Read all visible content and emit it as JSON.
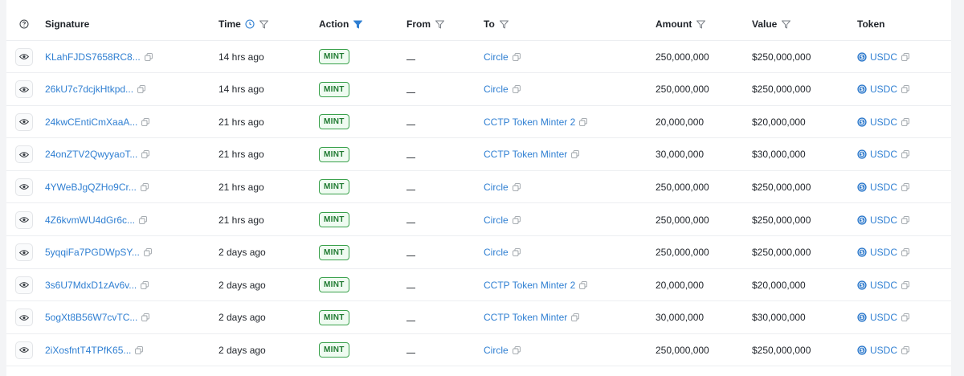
{
  "columns": {
    "signature": "Signature",
    "time": "Time",
    "action": "Action",
    "from": "From",
    "to": "To",
    "amount": "Amount",
    "value": "Value",
    "token": "Token"
  },
  "colors": {
    "link": "#2f7fd2",
    "badge_border": "#3aa14c",
    "active_filter": "#2f7fd2"
  },
  "rows": [
    {
      "signature": "KLahFJDS7658RC8...",
      "time": "14 hrs ago",
      "action": "MINT",
      "from": "",
      "to": "Circle",
      "amount": "250,000,000",
      "value": "$250,000,000",
      "token": "USDC"
    },
    {
      "signature": "26kU7c7dcjkHtkpd...",
      "time": "14 hrs ago",
      "action": "MINT",
      "from": "",
      "to": "Circle",
      "amount": "250,000,000",
      "value": "$250,000,000",
      "token": "USDC"
    },
    {
      "signature": "24kwCEntiCmXaaA...",
      "time": "21 hrs ago",
      "action": "MINT",
      "from": "",
      "to": "CCTP Token Minter 2",
      "amount": "20,000,000",
      "value": "$20,000,000",
      "token": "USDC"
    },
    {
      "signature": "24onZTV2QwyyaoT...",
      "time": "21 hrs ago",
      "action": "MINT",
      "from": "",
      "to": "CCTP Token Minter",
      "amount": "30,000,000",
      "value": "$30,000,000",
      "token": "USDC"
    },
    {
      "signature": "4YWeBJgQZHo9Cr...",
      "time": "21 hrs ago",
      "action": "MINT",
      "from": "",
      "to": "Circle",
      "amount": "250,000,000",
      "value": "$250,000,000",
      "token": "USDC"
    },
    {
      "signature": "4Z6kvmWU4dGr6c...",
      "time": "21 hrs ago",
      "action": "MINT",
      "from": "",
      "to": "Circle",
      "amount": "250,000,000",
      "value": "$250,000,000",
      "token": "USDC"
    },
    {
      "signature": "5yqqiFa7PGDWpSY...",
      "time": "2 days ago",
      "action": "MINT",
      "from": "",
      "to": "Circle",
      "amount": "250,000,000",
      "value": "$250,000,000",
      "token": "USDC"
    },
    {
      "signature": "3s6U7MdxD1zAv6v...",
      "time": "2 days ago",
      "action": "MINT",
      "from": "",
      "to": "CCTP Token Minter 2",
      "amount": "20,000,000",
      "value": "$20,000,000",
      "token": "USDC"
    },
    {
      "signature": "5ogXt8B56W7cvTC...",
      "time": "2 days ago",
      "action": "MINT",
      "from": "",
      "to": "CCTP Token Minter",
      "amount": "30,000,000",
      "value": "$30,000,000",
      "token": "USDC"
    },
    {
      "signature": "2iXosfntT4TPfK65...",
      "time": "2 days ago",
      "action": "MINT",
      "from": "",
      "to": "Circle",
      "amount": "250,000,000",
      "value": "$250,000,000",
      "token": "USDC"
    }
  ]
}
